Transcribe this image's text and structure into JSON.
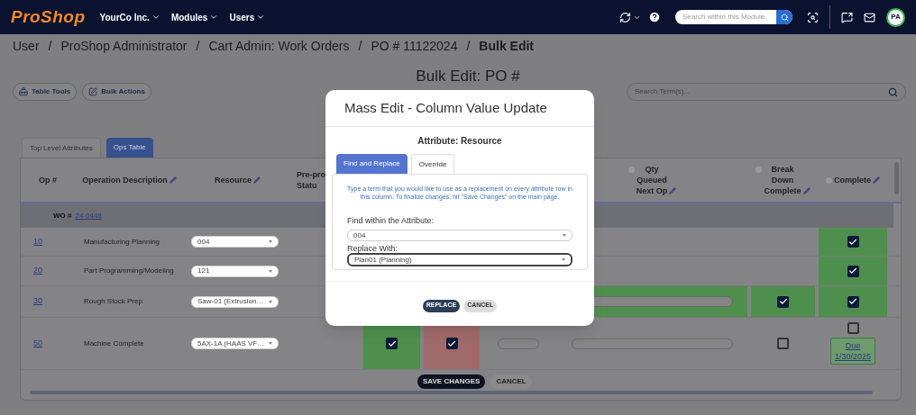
{
  "nav": {
    "logo": "ProShop",
    "menus": [
      "YourCo Inc.",
      "Modules",
      "Users"
    ],
    "search": {
      "placeholder": "Search within this Module"
    },
    "avatar": "PA"
  },
  "breadcrumb": {
    "separator": "/",
    "items": [
      "User",
      "ProShop Administrator",
      "Cart Admin: Work Orders",
      "PO # 11122024",
      "Bulk Edit"
    ]
  },
  "page_title": "Bulk Edit: PO #",
  "toolbar": [
    "Table Tools",
    "Bulk Actions"
  ],
  "search": {
    "placeholder": "Search Term(s)..."
  },
  "tabs": [
    {
      "label": "Top Level Attributes",
      "selected": false
    },
    {
      "label": "Ops Table",
      "selected": true
    }
  ],
  "table": {
    "columns": [
      {
        "label": "Op #",
        "editable": false,
        "info": false
      },
      {
        "label": "Operation Description",
        "editable": true,
        "info": false
      },
      {
        "label": "Resource",
        "editable": true,
        "info": false
      },
      {
        "label": "Pre-pro\nStatu",
        "editable": false,
        "info": false
      },
      {
        "label": "Qty\nQueued\nNext Op",
        "editable": true,
        "info": true
      },
      {
        "label": "Break\nDown\nComplete",
        "editable": true,
        "info": true
      },
      {
        "label": "Complete",
        "editable": true,
        "info": true
      }
    ],
    "group": {
      "label": "WO #",
      "link": "24-0448"
    },
    "rows": [
      {
        "op": "10",
        "description": "Manufacturing Planning",
        "resource": "004",
        "cells": [
          {
            "kind": "blank"
          },
          {
            "kind": "blank"
          },
          {
            "kind": "blank"
          },
          {
            "kind": "blank"
          },
          {
            "kind": "blank"
          },
          {
            "kind": "blank"
          },
          {
            "kind": "checkbox",
            "checked": true,
            "color": "#4e8f4e"
          }
        ]
      },
      {
        "op": "20",
        "description": "Part Programming/Modeling",
        "resource": "121",
        "cells": [
          {
            "kind": "blank"
          },
          {
            "kind": "blank"
          },
          {
            "kind": "blank"
          },
          {
            "kind": "blank"
          },
          {
            "kind": "blank"
          },
          {
            "kind": "blank"
          },
          {
            "kind": "checkbox",
            "checked": true,
            "color": "#4e8f4e"
          }
        ]
      },
      {
        "op": "30",
        "description": "Rough Stock Prep",
        "resource": "Saw-01 (Extrusion…",
        "cells": [
          {
            "kind": "blank"
          },
          {
            "kind": "blank"
          },
          {
            "kind": "blank"
          },
          {
            "kind": "blank"
          },
          {
            "kind": "pill",
            "color": "#4e8f4e"
          },
          {
            "kind": "checkbox",
            "checked": true,
            "color": "#4e8f4e"
          },
          {
            "kind": "checkbox",
            "checked": true,
            "color": "#4e8f4e"
          }
        ]
      },
      {
        "op": "50",
        "description": "Machine Complete",
        "resource": "5AX-1A (HAAS VF…",
        "cells": [
          {
            "kind": "blank"
          },
          {
            "kind": "checkbox",
            "checked": true,
            "color": "#4e8f4e"
          },
          {
            "kind": "checkbox",
            "checked": true,
            "color": "#a06a6a"
          },
          {
            "kind": "pill"
          },
          {
            "kind": "pill"
          },
          {
            "kind": "checkbox",
            "checked": false
          },
          {
            "kind": "checkbox",
            "checked": false,
            "due": "Due\n1/30/2025"
          }
        ]
      }
    ]
  },
  "footer_buttons": [
    {
      "label": "SAVE CHANGES",
      "kind": "primary"
    },
    {
      "label": "CANCEL",
      "kind": "secondary"
    }
  ],
  "modal": {
    "title": "Mass Edit - Column Value Update",
    "attribute": "Attribute: Resource",
    "tabs": [
      {
        "label": "Find and Replace",
        "selected": true
      },
      {
        "label": "Override",
        "selected": false
      }
    ],
    "info": "Type a term that you would like to use as a replacement on every attribute row in this column. To finalize changes, hit \"Save Changes\" on the main page.",
    "find": {
      "label": "Find within the Attribute:",
      "value": "004"
    },
    "replace": {
      "label": "Replace With:",
      "value": "Plan01 (Planning)"
    },
    "buttons": [
      {
        "label": "REPLACE",
        "kind": "primary"
      },
      {
        "label": "CANCEL",
        "kind": "secondary"
      }
    ]
  }
}
